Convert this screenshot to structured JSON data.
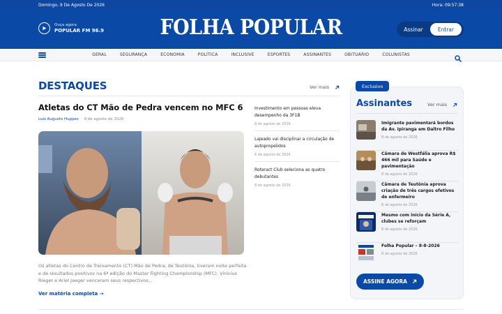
{
  "topbar": {
    "date": "Domingo, 9 De Agosto De 2026",
    "time": "Hora: 09:57:38"
  },
  "radio": {
    "line1": "Ouça agora",
    "line2": "POPULAR FM 96.9"
  },
  "brand": {
    "logo_text": "FOLHA POPULAR"
  },
  "auth": {
    "subscribe_label": "Assinar",
    "login_label": "Entrar"
  },
  "nav": {
    "items": [
      "GERAL",
      "SEGURANÇA",
      "ECONOMIA",
      "POLÍTICA",
      "INCLUSIVE",
      "ESPORTES",
      "ASSINANTES",
      "OBITUÁRIO",
      "COLUNISTAS"
    ]
  },
  "destaques": {
    "title": "DESTAQUES",
    "more_label": "Ver mais",
    "lead": {
      "title": "Atletas do CT Mão de Pedra vencem no MFC 6",
      "author": "Luis Augusto Huppes",
      "date": "9 de agosto de 2026",
      "excerpt": "Os atletas do Centro de Treinamento (CT) Mão de Pedra, de Teutônia, tiveram noite perfeita e de resultados positivos na 6ª edição do Master Fighting Championship (MFC). Vinicius Rieger e Ariel Jaeger venceram seus respectivos...",
      "link_label": "Ver matéria completa →"
    },
    "side": [
      {
        "title": "Investimento em pessoas eleva desempenho da 3F1B",
        "date": "8 de agosto de 2026"
      },
      {
        "title": "Lajeado vai disciplinar a circulação de autopropelidos",
        "date": "8 de agosto de 2026"
      },
      {
        "title": "Rotaract Club seleciona as quatro debutantes",
        "date": "8 de agosto de 2026"
      }
    ]
  },
  "assinantes": {
    "badge": "Exclusivo",
    "title": "Assinantes",
    "more_label": "Ver mais",
    "items": [
      {
        "title": "Imigrante pavimentará bordos da Av. Ipiranga em Daltro Filho",
        "date": "8 de agosto de 2026"
      },
      {
        "title": "Câmara de Westfália aprova R$ 466 mil para Saúde e pavimentação",
        "date": "8 de agosto de 2026"
      },
      {
        "title": "Câmara de Teutônia aprova criação de três cargos efetivos de enfermeiro",
        "date": "8 de agosto de 2026"
      },
      {
        "title": "Mesmo com início da Série A, clubes se reforçam",
        "date": "8 de agosto de 2026"
      },
      {
        "title": "Folha Popular – 8-8-2026",
        "date": "8 de agosto de 2026"
      }
    ],
    "cta_label": "ASSINE AGORA"
  },
  "colors": {
    "brand_blue": "#0a4aa6"
  }
}
